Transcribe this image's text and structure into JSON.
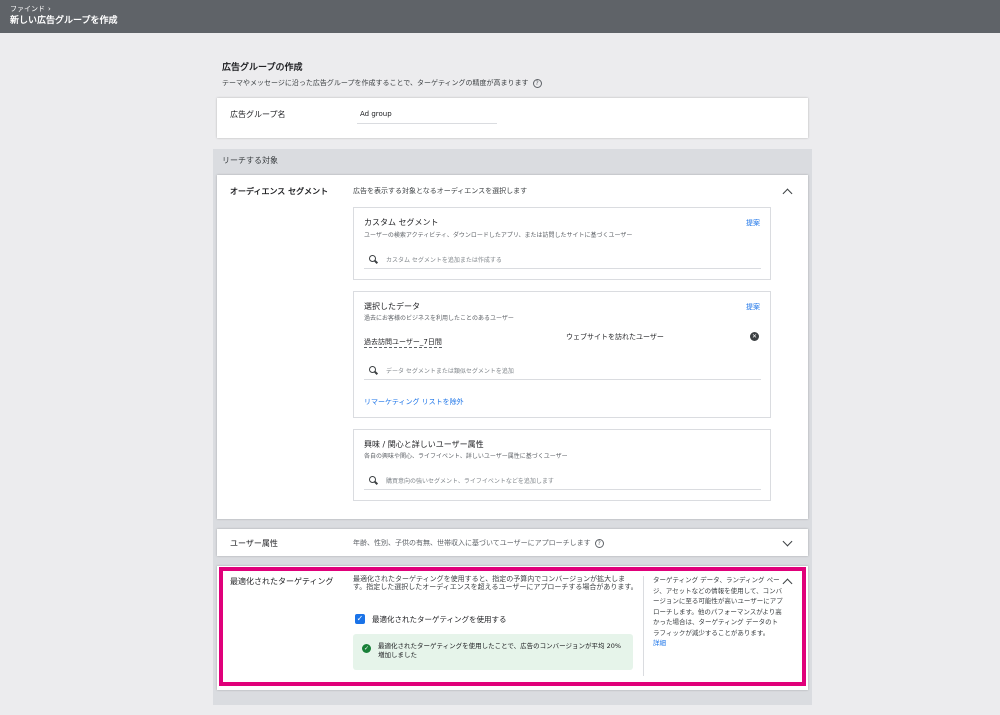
{
  "topbar": {
    "breadcrumb": "ファインド",
    "title": "新しい広告グループを作成"
  },
  "header": {
    "title": "広告グループの作成",
    "description": "テーマやメッセージに沿った広告グループを作成することで、ターゲティングの精度が高まります"
  },
  "ad_group": {
    "label": "広告グループ名",
    "value": "Ad group"
  },
  "reach": {
    "title": "リーチする対象"
  },
  "audience": {
    "label": "オーディエンス セグメント",
    "description": "広告を表示する対象となるオーディエンスを選択します",
    "custom": {
      "title": "カスタム セグメント",
      "description": "ユーザーの検索アクティビティ、ダウンロードしたアプリ、または訪問したサイトに基づくユーザー",
      "link": "提案",
      "placeholder": "カスタム セグメントを追加または作成する"
    },
    "your_data": {
      "title": "選択したデータ",
      "description": "過去にお客様のビジネスを利用したことのあるユーザー",
      "link": "提案",
      "segment_name": "過去訪問ユーザー_7日間",
      "segment_type": "ウェブサイトを訪れたユーザー",
      "placeholder": "データ セグメントまたは類似セグメントを追加",
      "exclude_link": "リマーケティング リストを除外"
    },
    "interests": {
      "title": "興味 / 関心と詳しいユーザー属性",
      "description": "各自の興味や関心、ライフイベント、詳しいユーザー属性に基づくユーザー",
      "placeholder": "購買意向の強いセグメント、ライフイベントなどを追加します"
    }
  },
  "demographics": {
    "label": "ユーザー属性",
    "description": "年齢、性別、子供の有無、世帯収入に基づいてユーザーにアプローチします"
  },
  "optimized": {
    "label": "最適化されたターゲティング",
    "description": "最適化されたターゲティングを使用すると、指定の予算内でコンバージョンが拡大します。指定した選択したオーディエンスを超えるユーザーにアプローチする場合があります。",
    "checkbox_label": "最適化されたターゲティングを使用する",
    "checked": true,
    "info": "最適化されたターゲティングを使用したことで、広告のコンバージョンが平均 20% 増加しました",
    "side_text": "ターゲティング データ、ランディング ページ、アセットなどの情報を使用して、コンバージョンに至る可能性が高いユーザーにアプローチします。他のパフォーマンスがより高かった場合は、ターゲティング データのトラフィックが減少することがあります。",
    "side_link": "詳細"
  },
  "colors": {
    "topbar": "#5f6368",
    "accent": "#1a73e8",
    "highlight": "#e0007a",
    "success": "#188038"
  }
}
